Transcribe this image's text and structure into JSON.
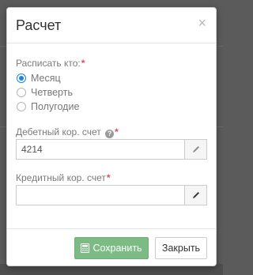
{
  "dialog": {
    "title": "Расчет",
    "close_symbol": "×"
  },
  "distribute": {
    "label": "Расписать кто:",
    "required_mark": "*",
    "options": [
      {
        "label": "Месяц",
        "checked": true
      },
      {
        "label": "Четверть",
        "checked": false
      },
      {
        "label": "Полугодие",
        "checked": false
      }
    ]
  },
  "debit": {
    "label": "Дебетный кор. счет",
    "help_symbol": "?",
    "required_mark": "*",
    "value": "4214",
    "edit_icon": "pencil-icon"
  },
  "credit": {
    "label": "Кредитный кор. счет",
    "required_mark": "*",
    "value": "",
    "edit_icon": "pencil-icon"
  },
  "footer": {
    "save_label": "Сохранить",
    "save_icon": "calculator-icon",
    "close_label": "Закрыть"
  },
  "colors": {
    "accent_radio": "#1e88d8",
    "required": "#d9534f",
    "save_button": "#7dbb85"
  }
}
